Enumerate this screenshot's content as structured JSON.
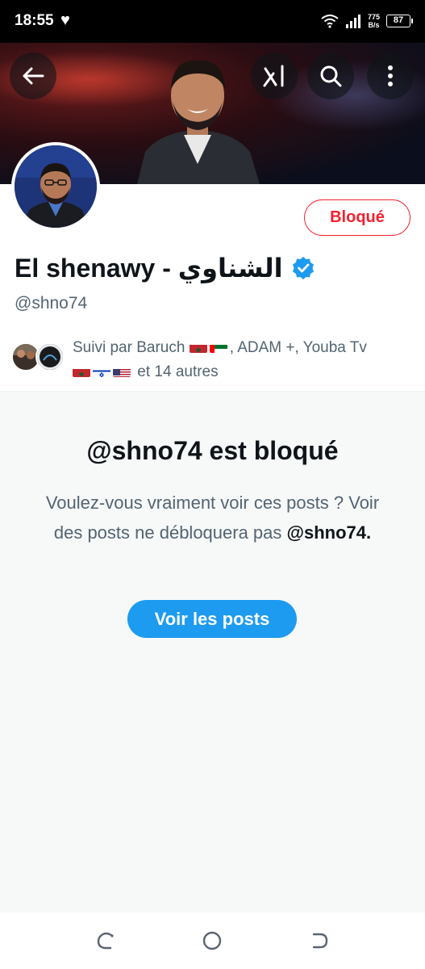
{
  "status_bar": {
    "time": "18:55",
    "net_speed_value": "775",
    "net_speed_unit": "B/s",
    "battery": "87",
    "icons": [
      "heart-icon",
      "wifi-icon",
      "signal-icon",
      "battery-icon"
    ]
  },
  "header": {
    "icons": [
      "back-arrow-icon",
      "grok-icon",
      "search-icon",
      "more-vertical-icon"
    ]
  },
  "profile": {
    "blocked_label": "Bloqué",
    "display_name": "El shenawy - الشناوي",
    "handle": "@shno74",
    "followed_by": {
      "prefix": "Suivi par Baruch",
      "middle": ", ADAM +, Youba Tv",
      "suffix": "et 14 autres"
    }
  },
  "blocked_notice": {
    "title": "@shno74 est bloqué",
    "desc_part1": "Voulez-vous vraiment voir ces posts ? Voir des posts ne débloquera pas",
    "desc_handle": "@shno74.",
    "button_label": "Voir les posts"
  },
  "colors": {
    "accent": "#1d9bf0",
    "blocked_red": "#f4212e",
    "secondary_text": "#536471",
    "primary_text": "#0f1419",
    "panel_bg": "#f7f9f9"
  }
}
